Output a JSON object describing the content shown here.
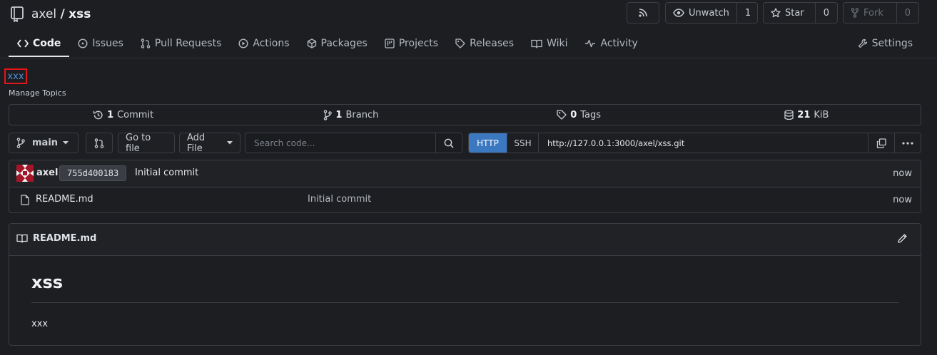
{
  "repo": {
    "owner": "axel",
    "separator": "/",
    "name": "xss"
  },
  "actions": {
    "unwatch_label": "Unwatch",
    "watch_count": "1",
    "star_label": "Star",
    "star_count": "0",
    "fork_label": "Fork",
    "fork_count": "0"
  },
  "tabs": [
    {
      "label": "Code",
      "icon": "code-icon",
      "active": true
    },
    {
      "label": "Issues",
      "icon": "issue-icon"
    },
    {
      "label": "Pull Requests",
      "icon": "pull-request-icon"
    },
    {
      "label": "Actions",
      "icon": "play-icon"
    },
    {
      "label": "Packages",
      "icon": "package-icon"
    },
    {
      "label": "Projects",
      "icon": "project-icon"
    },
    {
      "label": "Releases",
      "icon": "tag-icon"
    },
    {
      "label": "Wiki",
      "icon": "book-icon"
    },
    {
      "label": "Activity",
      "icon": "pulse-icon"
    }
  ],
  "settings_label": "Settings",
  "topic": "xxx",
  "manage_topics": "Manage Topics",
  "stats": {
    "commits": {
      "count": "1",
      "label": "Commit"
    },
    "branches": {
      "count": "1",
      "label": "Branch"
    },
    "tags": {
      "count": "0",
      "label": "Tags"
    },
    "size": {
      "count": "21",
      "label": "KiB"
    }
  },
  "toolbar": {
    "branch": "main",
    "go_to_file": "Go to file",
    "add_file": "Add File",
    "search_placeholder": "Search code...",
    "http": "HTTP",
    "ssh": "SSH",
    "clone_url": "http://127.0.0.1:3000/axel/xss.git"
  },
  "latest_commit": {
    "author": "axel",
    "sha": "755d400183",
    "message": "Initial commit",
    "time": "now"
  },
  "files": [
    {
      "name": "README.md",
      "message": "Initial commit",
      "time": "now"
    }
  ],
  "readme": {
    "filename": "README.md",
    "heading": "xss",
    "body": "xxx"
  },
  "colors": {
    "background": "#1c1e22",
    "accent": "#3c78c0",
    "topic_highlight": "#e0161b",
    "link": "#4e8fd6"
  }
}
